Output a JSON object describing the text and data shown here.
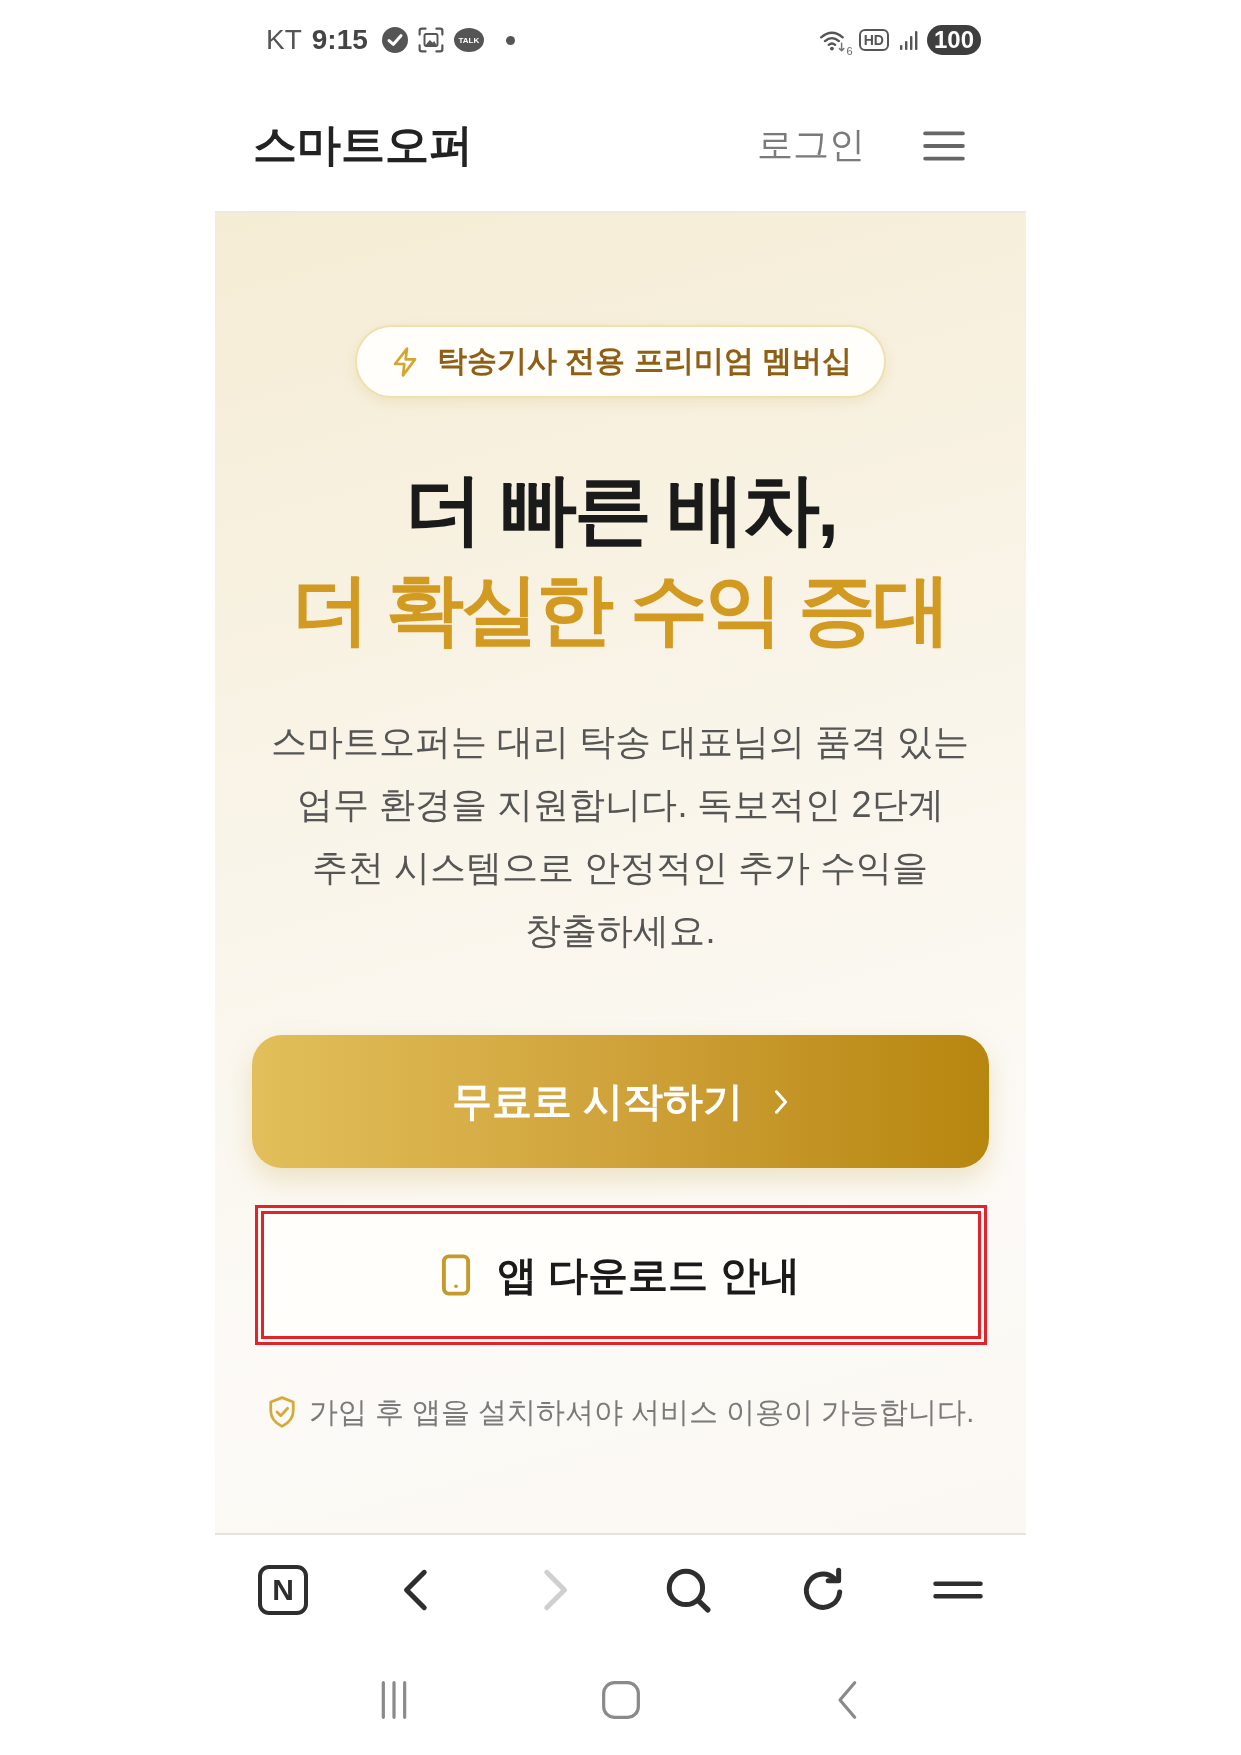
{
  "status_bar": {
    "carrier": "KT",
    "time": "9:15",
    "notifications": [
      {
        "kind": "check"
      },
      {
        "kind": "screenshot"
      },
      {
        "kind": "talk",
        "label": "TALK"
      },
      {
        "kind": "dot"
      }
    ],
    "wifi_label": "6",
    "hd_label": "HD",
    "battery": "100"
  },
  "header": {
    "logo": "스마트오퍼",
    "login": "로그인"
  },
  "hero": {
    "badge": "탁송기사 전용 프리미엄 멤버십",
    "headline": [
      {
        "text": "더 빠른 배차,",
        "accent": false
      },
      {
        "text": "더 확실한 수익 증대",
        "accent": true
      }
    ],
    "description": "스마트오퍼는 대리 탁송 대표님의 품격 있는\n업무 환경을 지원합니다. 독보적인 2단계\n추천 시스템으로 안정적인 추가 수익을\n창출하세요.",
    "primary_button": {
      "label": "무료로 시작하기"
    },
    "download_button": {
      "label": "앱 다운로드 안내",
      "highlighted": true
    },
    "notice": "가입 후 앱을 설치하셔야 서비스 이용이 가능합니다."
  },
  "browser_toolbar": [
    {
      "kind": "n-box",
      "label": "N",
      "disabled": false
    },
    {
      "kind": "back",
      "disabled": false
    },
    {
      "kind": "forward",
      "disabled": true
    },
    {
      "kind": "search",
      "disabled": false
    },
    {
      "kind": "reload",
      "disabled": false
    },
    {
      "kind": "menu",
      "disabled": false
    }
  ],
  "system_nav": [
    {
      "kind": "recents"
    },
    {
      "kind": "home"
    },
    {
      "kind": "back"
    }
  ]
}
